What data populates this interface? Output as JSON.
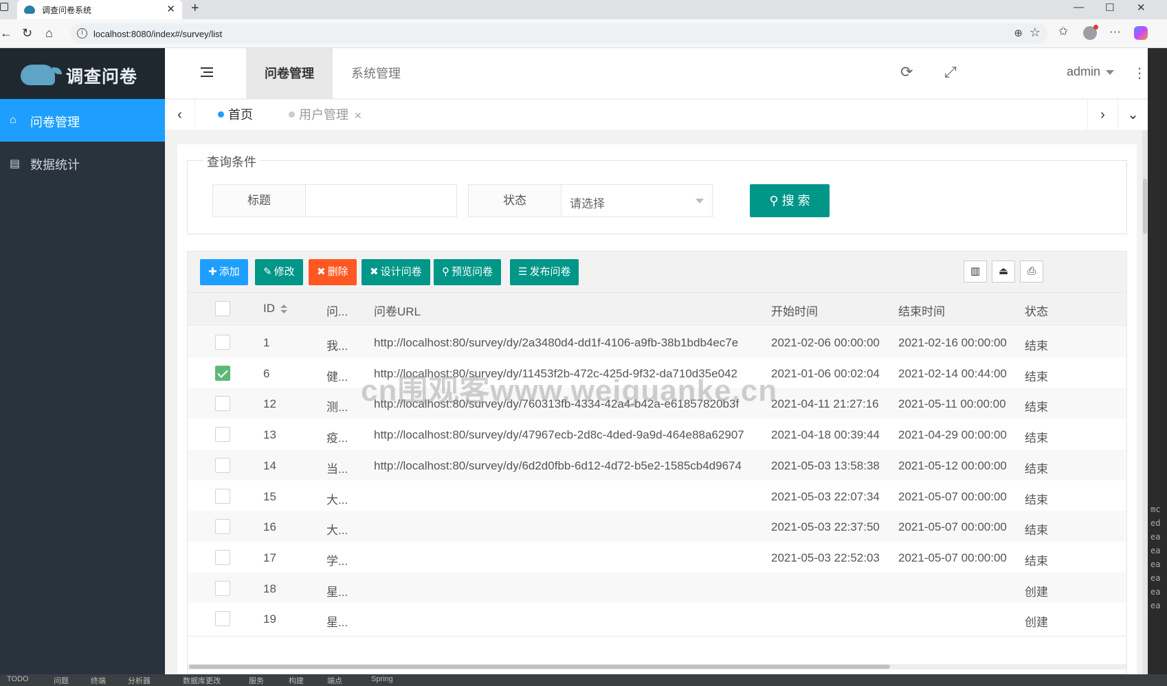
{
  "browser": {
    "tab_title": "调查问卷系统",
    "url": "localhost:8080/index#/survey/list"
  },
  "sidebar": {
    "brand": "调查问卷",
    "items": [
      {
        "label": "问卷管理",
        "icon": "home-icon"
      },
      {
        "label": "数据统计",
        "icon": "file-icon"
      }
    ]
  },
  "header": {
    "menus": [
      "问卷管理",
      "系统管理"
    ],
    "user": "admin"
  },
  "tabs": [
    {
      "label": "首页"
    },
    {
      "label": "用户管理"
    }
  ],
  "query": {
    "legend": "查询条件",
    "title_label": "标题",
    "status_label": "状态",
    "status_placeholder": "请选择",
    "search_label": "搜 索"
  },
  "toolbar": {
    "buttons": [
      {
        "label": "添加",
        "icon": "plus-icon",
        "color": "#1e9fff"
      },
      {
        "label": "修改",
        "icon": "pencil-icon",
        "color": "#009688"
      },
      {
        "label": "删除",
        "icon": "x-icon",
        "color": "#ff5722"
      },
      {
        "label": "设计问卷",
        "icon": "x-icon",
        "color": "#009688"
      },
      {
        "label": "预览问卷",
        "icon": "search-icon",
        "color": "#009688"
      },
      {
        "label": "发布问卷",
        "icon": "list-icon",
        "color": "#009688"
      }
    ]
  },
  "table": {
    "columns": [
      "ID",
      "问...",
      "问卷URL",
      "开始时间",
      "结束时间",
      "状态"
    ],
    "rows": [
      {
        "id": "1",
        "title": "我...",
        "url": "http://localhost:80/survey/dy/2a3480d4-dd1f-4106-a9fb-38b1bdb4ec7e",
        "start": "2021-02-06 00:00:00",
        "end": "2021-02-16 00:00:00",
        "status": "结束",
        "checked": false
      },
      {
        "id": "6",
        "title": "健...",
        "url": "http://localhost:80/survey/dy/11453f2b-472c-425d-9f32-da710d35e042",
        "start": "2021-01-06 00:02:04",
        "end": "2021-02-14 00:44:00",
        "status": "结束",
        "checked": true
      },
      {
        "id": "12",
        "title": "测...",
        "url": "http://localhost:80/survey/dy/760313fb-4334-42a4-b42a-e61857820b3f",
        "start": "2021-04-11 21:27:16",
        "end": "2021-05-11 00:00:00",
        "status": "结束",
        "checked": false
      },
      {
        "id": "13",
        "title": "疫...",
        "url": "http://localhost:80/survey/dy/47967ecb-2d8c-4ded-9a9d-464e88a62907",
        "start": "2021-04-18 00:39:44",
        "end": "2021-04-29 00:00:00",
        "status": "结束",
        "checked": false
      },
      {
        "id": "14",
        "title": "当...",
        "url": "http://localhost:80/survey/dy/6d2d0fbb-6d12-4d72-b5e2-1585cb4d9674",
        "start": "2021-05-03 13:58:38",
        "end": "2021-05-12 00:00:00",
        "status": "结束",
        "checked": false
      },
      {
        "id": "15",
        "title": "大...",
        "url": "",
        "start": "2021-05-03 22:07:34",
        "end": "2021-05-07 00:00:00",
        "status": "结束",
        "checked": false
      },
      {
        "id": "16",
        "title": "大...",
        "url": "",
        "start": "2021-05-03 22:37:50",
        "end": "2021-05-07 00:00:00",
        "status": "结束",
        "checked": false
      },
      {
        "id": "17",
        "title": "学...",
        "url": "",
        "start": "2021-05-03 22:52:03",
        "end": "2021-05-07 00:00:00",
        "status": "结束",
        "checked": false
      },
      {
        "id": "18",
        "title": "星...",
        "url": "",
        "start": "",
        "end": "",
        "status": "创建",
        "checked": false
      },
      {
        "id": "19",
        "title": "星...",
        "url": "",
        "start": "",
        "end": "",
        "status": "创建",
        "checked": false
      }
    ]
  },
  "watermark": "cn围观客www.weiguanke.cn",
  "ide_side": [
    "mc",
    "ed",
    "ea",
    "ea",
    "ea",
    "ea",
    "ea",
    "ea"
  ],
  "statusbar": [
    "TODO",
    "问题",
    "终端",
    "分析器",
    "数据库更改",
    "服务",
    "构建",
    "端点",
    "Spring"
  ],
  "colors": {
    "sidebar_bg": "#28333e",
    "active_blue": "#1e9fff",
    "primary_green": "#009688",
    "danger_orange": "#ff5722"
  }
}
